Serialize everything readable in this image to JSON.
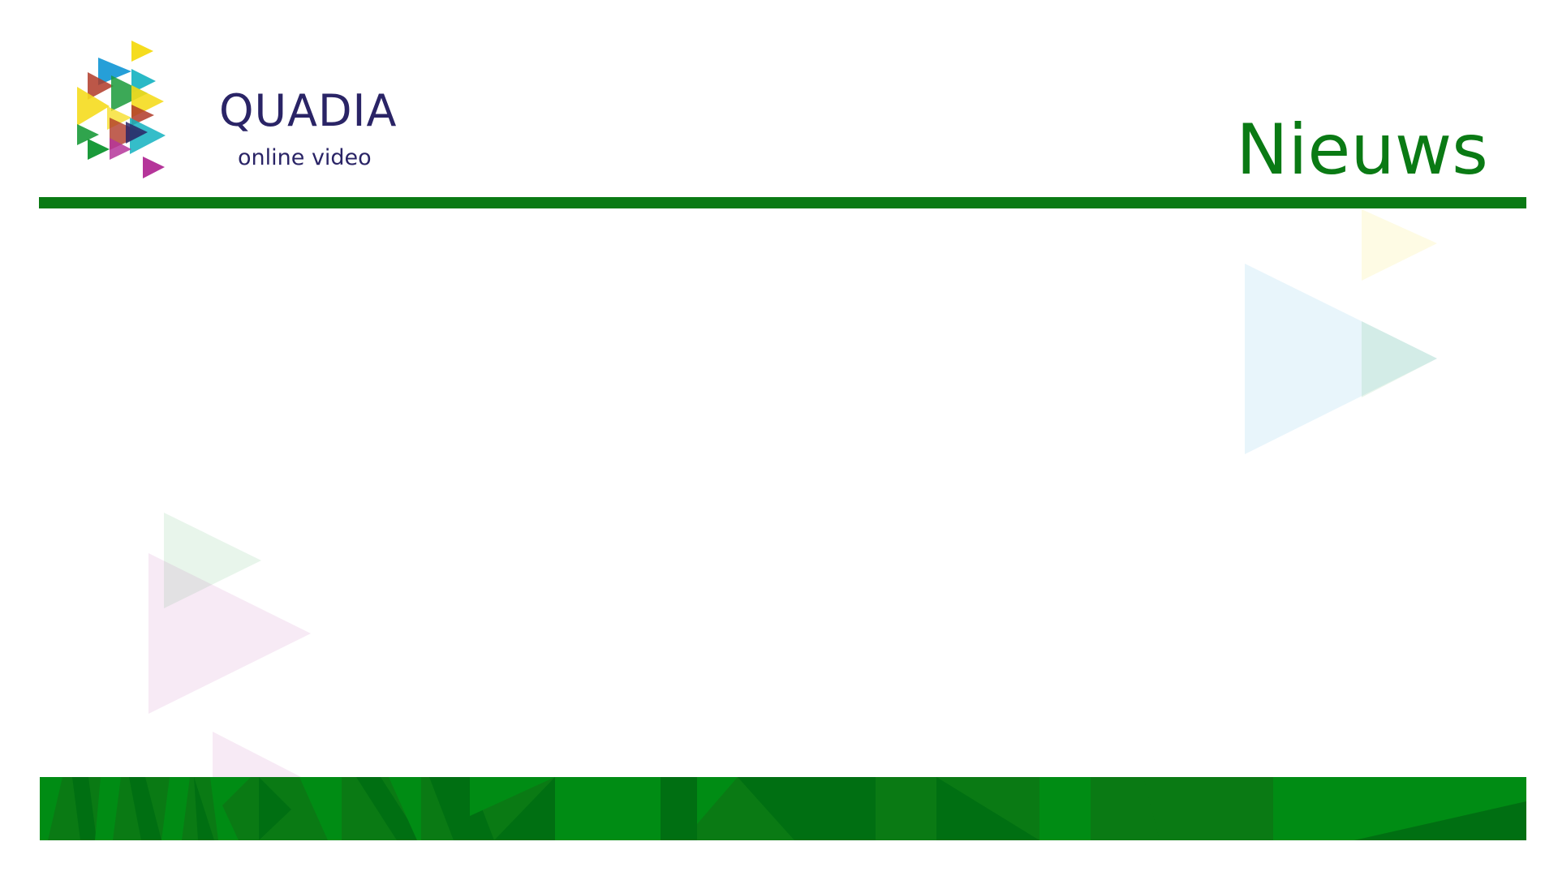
{
  "brand": {
    "name": "QUADIA",
    "tagline": "online video",
    "colors": {
      "navy": "#2a2466",
      "yellow": "#f5dc1e",
      "blue": "#1a9ad6",
      "teal": "#12b1c0",
      "green": "#1a9a3a",
      "red": "#b03a28",
      "magenta": "#b5359a"
    }
  },
  "page": {
    "title": "Nieuws"
  },
  "theme": {
    "accent": "#0a7a14",
    "accent_light": "#008c14",
    "background": "#ffffff"
  }
}
